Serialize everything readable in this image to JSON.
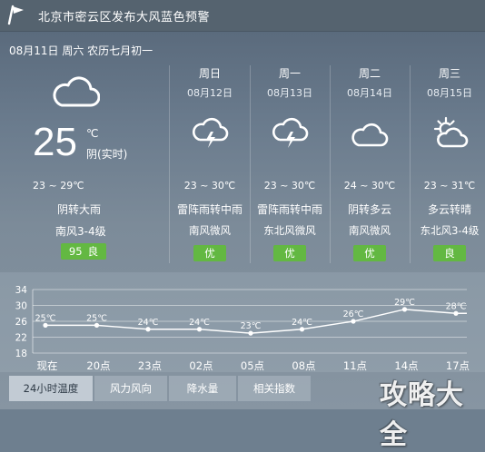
{
  "header": {
    "alert_title": "北京市密云区发布大风蓝色预警",
    "logo_icon": "flag-icon"
  },
  "date_line": "08月11日 周六 农历七月初一",
  "today": {
    "icon": "cloudy-icon",
    "temp": "25",
    "unit": "℃",
    "realtime": "阴(实时)",
    "range": "23 ~ 29℃",
    "condition": "阴转大雨",
    "wind": "南风3-4级",
    "aqi_value": "95",
    "aqi_label": "良",
    "aqi_color": "#63b842"
  },
  "forecast": [
    {
      "weekday": "周日",
      "date": "08月12日",
      "icon": "thunder-shower-icon",
      "range": "23 ~ 30℃",
      "condition": "雷阵雨转中雨",
      "wind": "南风微风",
      "aqi": "优"
    },
    {
      "weekday": "周一",
      "date": "08月13日",
      "icon": "thunder-shower-icon",
      "range": "23 ~ 30℃",
      "condition": "雷阵雨转中雨",
      "wind": "东北风微风",
      "aqi": "优"
    },
    {
      "weekday": "周二",
      "date": "08月14日",
      "icon": "cloudy-icon",
      "range": "24 ~ 30℃",
      "condition": "阴转多云",
      "wind": "南风微风",
      "aqi": "优"
    },
    {
      "weekday": "周三",
      "date": "08月15日",
      "icon": "partly-cloudy-icon",
      "range": "23 ~ 31℃",
      "condition": "多云转晴",
      "wind": "东北风3-4级",
      "aqi": "良"
    }
  ],
  "chart_data": {
    "type": "line",
    "title": "",
    "xlabel": "",
    "ylabel": "",
    "categories": [
      "现在",
      "20点",
      "23点",
      "02点",
      "05点",
      "08点",
      "11点",
      "14点",
      "17点"
    ],
    "yticks": [
      18,
      22,
      26,
      30,
      34
    ],
    "ylim": [
      18,
      34
    ],
    "grid": true,
    "series": [
      {
        "values": [
          25,
          25,
          24,
          24,
          23,
          24,
          26,
          29,
          28
        ],
        "labels": [
          "25℃",
          "25℃",
          "24℃",
          "24℃",
          "23℃",
          "24℃",
          "26℃",
          "29℃",
          "28℃"
        ]
      }
    ]
  },
  "tabs": [
    {
      "label": "24小时温度",
      "active": true
    },
    {
      "label": "风力风向",
      "active": false
    },
    {
      "label": "降水量",
      "active": false
    },
    {
      "label": "相关指数",
      "active": false
    }
  ],
  "watermark": "攻略大全",
  "colors": {
    "aqi_green": "#63b842",
    "line": "#ffffff",
    "grid": "#ffffff"
  }
}
